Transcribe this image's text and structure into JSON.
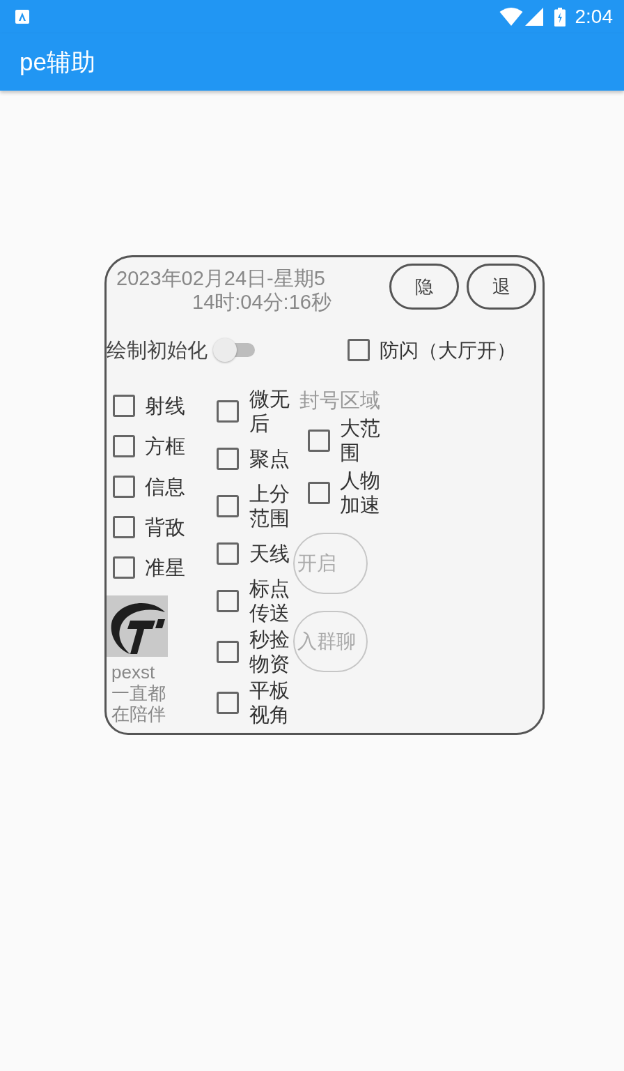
{
  "status_bar": {
    "time": "2:04"
  },
  "app_bar": {
    "title": "pe辅助"
  },
  "panel": {
    "date": "2023年02月24日-星期5",
    "clock": "14时:04分:16秒",
    "header_buttons": [
      {
        "label": "隐"
      },
      {
        "label": "退"
      }
    ],
    "draw_init": {
      "label": "绘制初始化",
      "on": false
    },
    "anti_flash": {
      "label": "防闪（大厅开）",
      "checked": false
    },
    "columns": [
      {
        "items": [
          {
            "label": "射线",
            "checked": false
          },
          {
            "label": "方框",
            "checked": false
          },
          {
            "label": "信息",
            "checked": false
          },
          {
            "label": "背敌",
            "checked": false
          },
          {
            "label": "准星",
            "checked": false
          }
        ],
        "caption_lines": [
          "pexst",
          "一直都",
          "在陪伴"
        ]
      },
      {
        "items": [
          {
            "label": "微无后",
            "checked": false
          },
          {
            "label": "聚点",
            "checked": false
          },
          {
            "label": "上分范围",
            "checked": false
          },
          {
            "label": "天线",
            "checked": false
          },
          {
            "label": "标点传送",
            "checked": false
          },
          {
            "label": "秒捡物资",
            "checked": false
          },
          {
            "label": "平板视角",
            "checked": false
          }
        ]
      },
      {
        "heading": "封号区域",
        "items": [
          {
            "label": "大范围",
            "checked": false
          },
          {
            "label": "人物加速",
            "checked": false
          }
        ]
      }
    ],
    "action_buttons": [
      {
        "label": "开启"
      },
      {
        "label": "入群聊"
      }
    ]
  }
}
